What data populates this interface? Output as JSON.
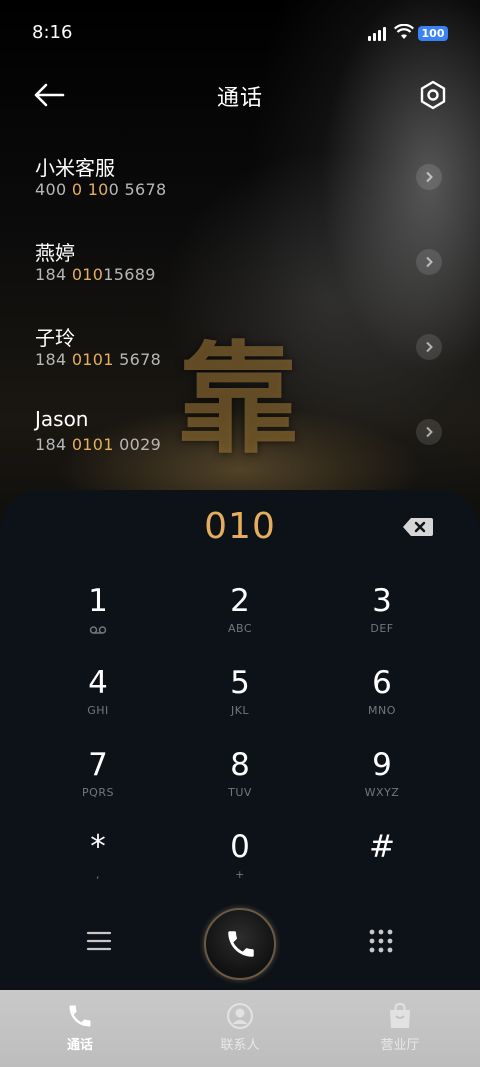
{
  "status_bar": {
    "time": "8:16",
    "battery": "100"
  },
  "header": {
    "title": "通话",
    "back_icon": "arrow-left-icon",
    "settings_icon": "gear-icon"
  },
  "background": {
    "glyph": "靠"
  },
  "contacts": [
    {
      "name": "小米客服",
      "num_pre": "400 ",
      "num_hl": "0 10",
      "num_post": "0 5678"
    },
    {
      "name": "燕婷",
      "num_pre": "184 ",
      "num_hl": "010",
      "num_post": "15689"
    },
    {
      "name": "子玲",
      "num_pre": "184 ",
      "num_hl": "0101",
      "num_post": " 5678"
    },
    {
      "name": "Jason",
      "num_pre": "184 ",
      "num_hl": "0101",
      "num_post": " 0029"
    }
  ],
  "dialpad": {
    "display": "010",
    "keys": [
      {
        "digit": "1",
        "letters": ""
      },
      {
        "digit": "2",
        "letters": "ABC"
      },
      {
        "digit": "3",
        "letters": "DEF"
      },
      {
        "digit": "4",
        "letters": "GHI"
      },
      {
        "digit": "5",
        "letters": "JKL"
      },
      {
        "digit": "6",
        "letters": "MNO"
      },
      {
        "digit": "7",
        "letters": "PQRS"
      },
      {
        "digit": "8",
        "letters": "TUV"
      },
      {
        "digit": "9",
        "letters": "WXYZ"
      },
      {
        "digit": "*",
        "letters": ","
      },
      {
        "digit": "0",
        "letters": "+"
      },
      {
        "digit": "#",
        "letters": ""
      }
    ]
  },
  "colors": {
    "accent": "#e4ae5c",
    "pad_bg": "#0d1218",
    "tabbar_bg": "#c4c4c4"
  },
  "tabs": [
    {
      "label": "通话",
      "icon": "phone-icon",
      "active": true
    },
    {
      "label": "联系人",
      "icon": "person-icon",
      "active": false
    },
    {
      "label": "营业厅",
      "icon": "shopping-bag-icon",
      "active": false
    }
  ]
}
